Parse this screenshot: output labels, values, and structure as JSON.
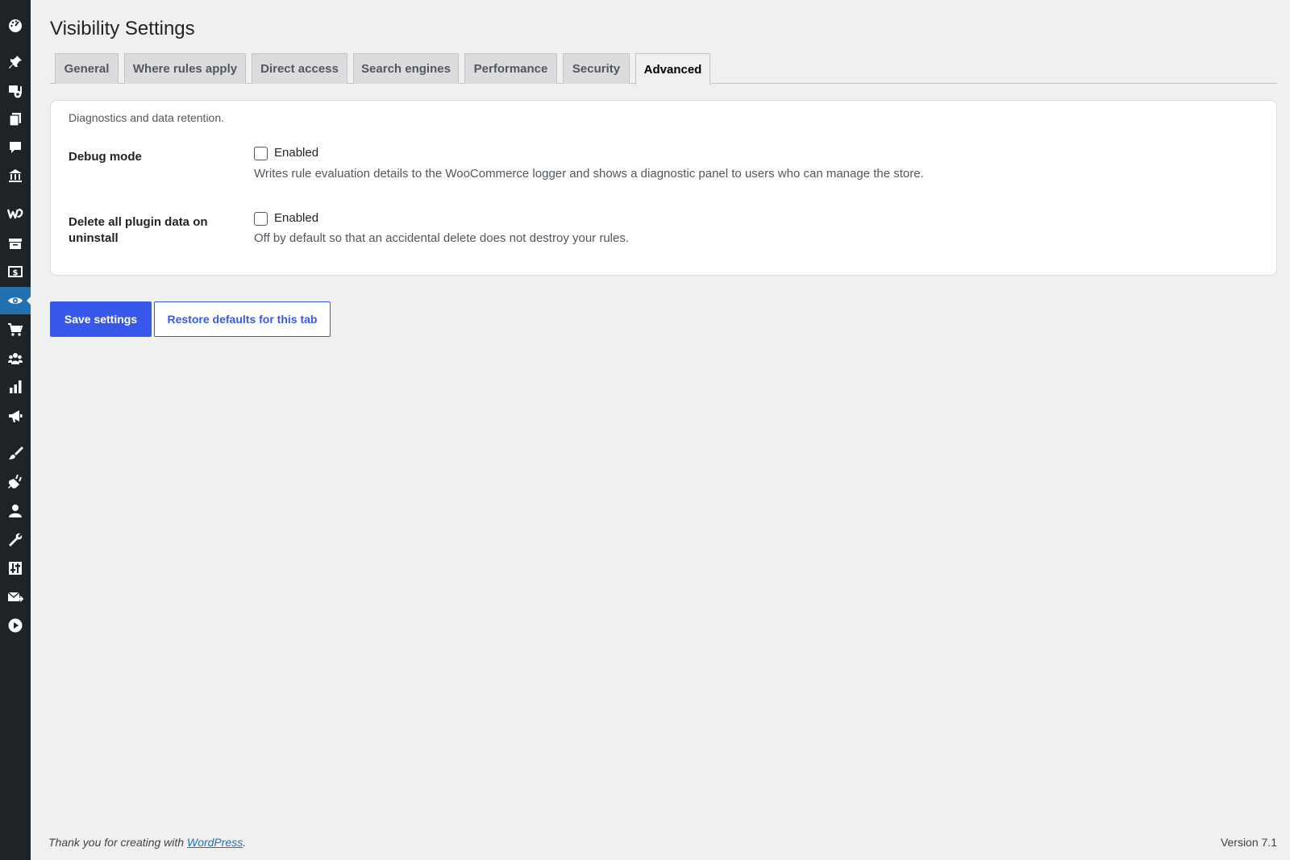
{
  "page": {
    "title": "Visibility Settings"
  },
  "sidebar": {
    "icons": [
      "dashboard-icon",
      "pin-icon",
      "media-icon",
      "pages-icon",
      "comments-icon",
      "bank-icon",
      "woocommerce-icon",
      "archive-icon",
      "money-icon",
      "visibility-icon",
      "cart-icon",
      "groups-icon",
      "chart-icon",
      "megaphone-icon",
      "brush-icon",
      "plugins-icon",
      "users-icon",
      "tools-icon",
      "settings-icon",
      "mail-icon",
      "video-icon"
    ],
    "active": "visibility-icon"
  },
  "tabs": [
    {
      "label": "General"
    },
    {
      "label": "Where rules apply"
    },
    {
      "label": "Direct access"
    },
    {
      "label": "Search engines"
    },
    {
      "label": "Performance"
    },
    {
      "label": "Security"
    },
    {
      "label": "Advanced",
      "active": true
    }
  ],
  "section": {
    "description": "Diagnostics and data retention.",
    "debug": {
      "label": "Debug mode",
      "checkbox_label": "Enabled",
      "checked": false,
      "help": "Writes rule evaluation details to the WooCommerce logger and shows a diagnostic panel to users who can manage the store."
    },
    "delete_data": {
      "label": "Delete all plugin data on uninstall",
      "checkbox_label": "Enabled",
      "checked": false,
      "help": "Off by default so that an accidental delete does not destroy your rules."
    }
  },
  "actions": {
    "save": "Save settings",
    "restore": "Restore defaults for this tab"
  },
  "footer": {
    "thanks_prefix": "Thank you for creating with ",
    "thanks_link": "WordPress",
    "thanks_suffix": ".",
    "version": "Version 7.1"
  },
  "colors": {
    "accent": "#3858e9",
    "sidebar": "#1d2327",
    "background": "#f0f0f1"
  }
}
